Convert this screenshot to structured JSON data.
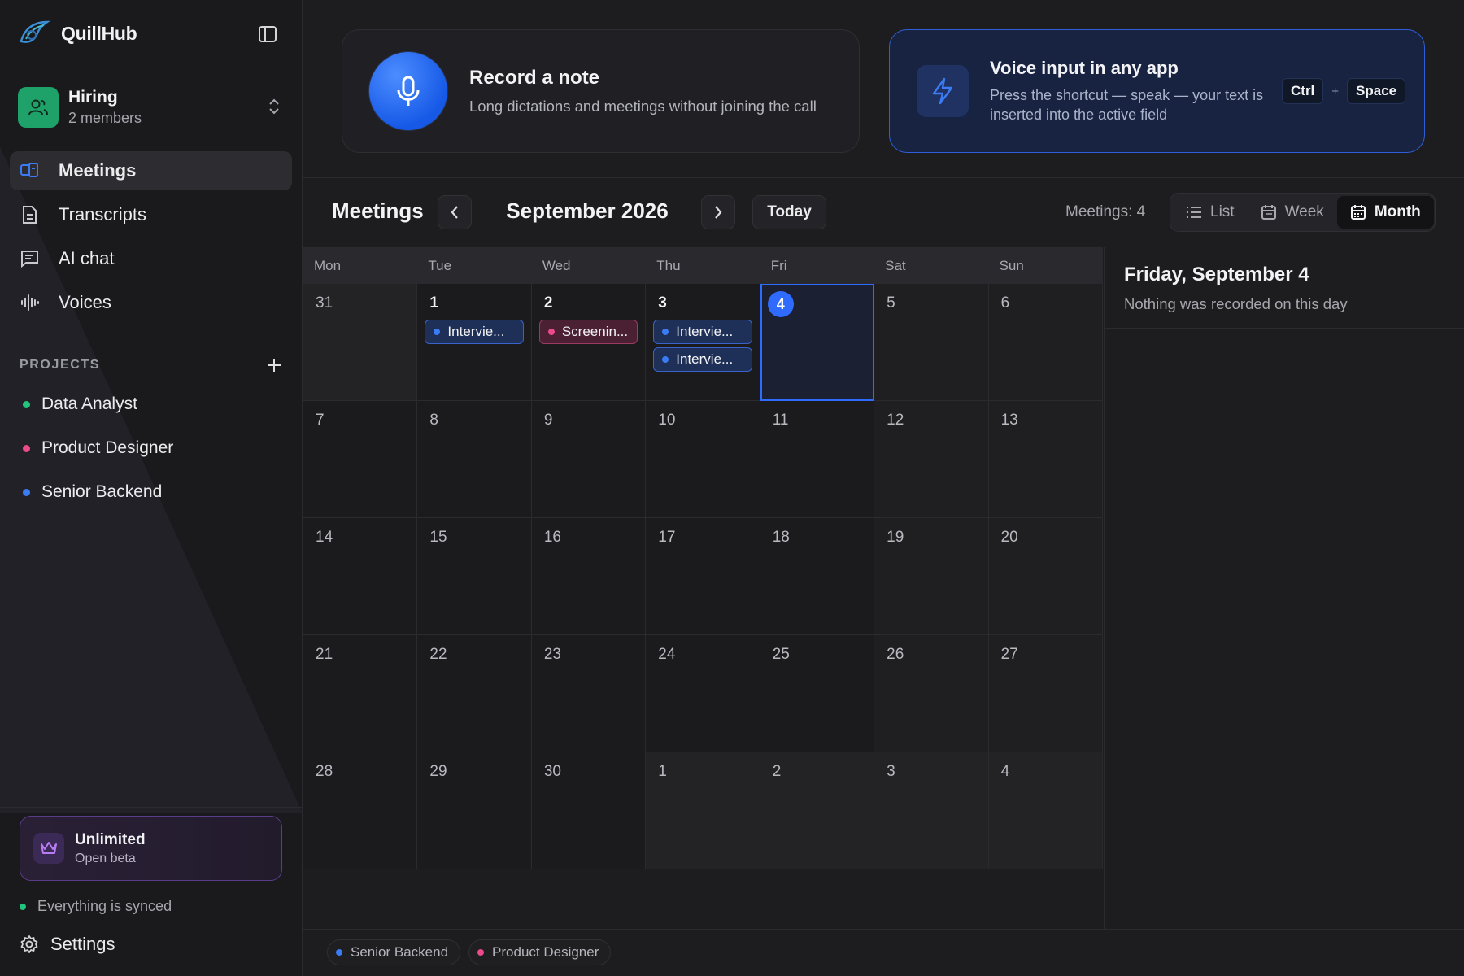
{
  "app": {
    "name": "QuillHub"
  },
  "workspace": {
    "name": "Hiring",
    "members": "2 members"
  },
  "nav": [
    {
      "label": "Meetings",
      "icon": "meetings-icon",
      "active": true
    },
    {
      "label": "Transcripts",
      "icon": "document-icon",
      "active": false
    },
    {
      "label": "AI chat",
      "icon": "chat-icon",
      "active": false
    },
    {
      "label": "Voices",
      "icon": "waveform-icon",
      "active": false
    }
  ],
  "projects": {
    "title": "PROJECTS",
    "items": [
      {
        "label": "Data Analyst",
        "color": "#22c37a"
      },
      {
        "label": "Product Designer",
        "color": "#ec4a8b"
      },
      {
        "label": "Senior Backend",
        "color": "#3b7cf5"
      }
    ]
  },
  "plan": {
    "title": "Unlimited",
    "subtitle": "Open beta"
  },
  "sync": {
    "label": "Everything is synced",
    "color": "#22c37a"
  },
  "settings": {
    "label": "Settings"
  },
  "record_card": {
    "title": "Record a note",
    "subtitle": "Long dictations and meetings without joining the call"
  },
  "voice_card": {
    "title": "Voice input in any app",
    "subtitle": "Press the shortcut — speak — your text is inserted into the active field",
    "keys": [
      "Ctrl",
      "Space"
    ],
    "plus": "+"
  },
  "toolbar": {
    "title": "Meetings",
    "month": "September 2026",
    "today_label": "Today",
    "count_label": "Meetings: 4",
    "views": [
      {
        "label": "List",
        "icon": "list-icon",
        "active": false
      },
      {
        "label": "Week",
        "icon": "calendar-week-icon",
        "active": false
      },
      {
        "label": "Month",
        "icon": "calendar-month-icon",
        "active": true
      }
    ]
  },
  "calendar": {
    "weekdays": [
      "Mon",
      "Tue",
      "Wed",
      "Thu",
      "Fri",
      "Sat",
      "Sun"
    ],
    "weeks": [
      [
        {
          "day": "31",
          "current": false,
          "events": []
        },
        {
          "day": "1",
          "current": true,
          "events": [
            {
              "label": "Intervie...",
              "color": "blue"
            }
          ]
        },
        {
          "day": "2",
          "current": true,
          "events": [
            {
              "label": "Screenin...",
              "color": "pink"
            }
          ]
        },
        {
          "day": "3",
          "current": true,
          "events": [
            {
              "label": "Intervie...",
              "color": "blue"
            },
            {
              "label": "Intervie...",
              "color": "blue"
            }
          ]
        },
        {
          "day": "4",
          "current": true,
          "selected": true,
          "events": []
        },
        {
          "day": "5",
          "current": false,
          "events": []
        },
        {
          "day": "6",
          "current": false,
          "events": []
        }
      ],
      [
        {
          "day": "7"
        },
        {
          "day": "8"
        },
        {
          "day": "9"
        },
        {
          "day": "10"
        },
        {
          "day": "11"
        },
        {
          "day": "12"
        },
        {
          "day": "13"
        }
      ],
      [
        {
          "day": "14"
        },
        {
          "day": "15"
        },
        {
          "day": "16"
        },
        {
          "day": "17"
        },
        {
          "day": "18"
        },
        {
          "day": "19"
        },
        {
          "day": "20"
        }
      ],
      [
        {
          "day": "21"
        },
        {
          "day": "22"
        },
        {
          "day": "23"
        },
        {
          "day": "24"
        },
        {
          "day": "25"
        },
        {
          "day": "26"
        },
        {
          "day": "27"
        }
      ],
      [
        {
          "day": "28"
        },
        {
          "day": "29"
        },
        {
          "day": "30"
        },
        {
          "day": "1",
          "outside": true
        },
        {
          "day": "2",
          "outside": true
        },
        {
          "day": "3",
          "outside": true
        },
        {
          "day": "4",
          "outside": true
        }
      ]
    ]
  },
  "detail": {
    "title": "Friday, September 4",
    "subtitle": "Nothing was recorded on this day"
  },
  "legend": [
    {
      "label": "Senior Backend",
      "color": "#3b7cf5"
    },
    {
      "label": "Product Designer",
      "color": "#ec4a8b"
    }
  ]
}
